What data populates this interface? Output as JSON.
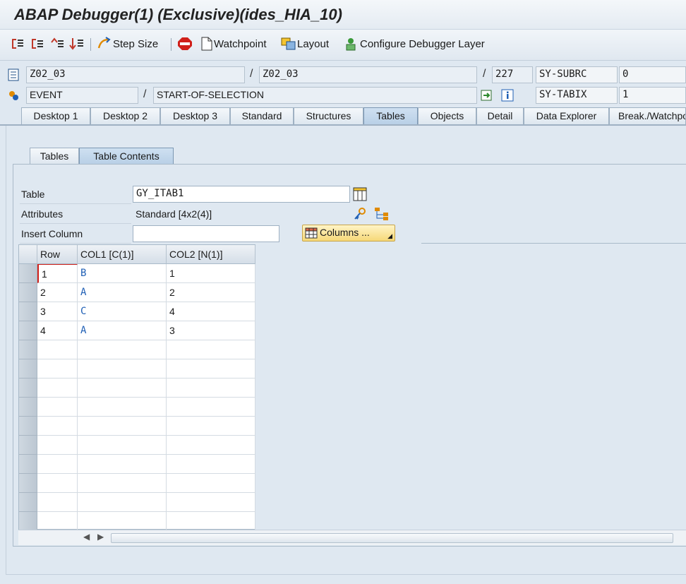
{
  "window": {
    "title": "ABAP Debugger(1)  (Exclusive)(ides_HIA_10)"
  },
  "toolbar": {
    "icons": [
      "step-into-icon",
      "step-over-icon",
      "return-icon",
      "continue-icon"
    ],
    "step_size_label": "Step Size",
    "watchpoint_label": "Watchpoint",
    "layout_label": "Layout",
    "configure_label": "Configure Debugger Layer"
  },
  "info": {
    "program": "Z02_03",
    "include": "Z02_03",
    "line": "227",
    "event_type": "EVENT",
    "event_name": "START-OF-SELECTION",
    "sy_subrc_label": "SY-SUBRC",
    "sy_subrc_value": "0",
    "sy_tabix_label": "SY-TABIX",
    "sy_tabix_value": "1",
    "slash": "/"
  },
  "tabs": [
    "Desktop 1",
    "Desktop 2",
    "Desktop 3",
    "Standard",
    "Structures",
    "Tables",
    "Objects",
    "Detail",
    "Data Explorer",
    "Break./Watchpoints"
  ],
  "active_tab": "Tables",
  "subtabs": [
    "Tables",
    "Table Contents"
  ],
  "active_subtab": "Table Contents",
  "form": {
    "table_label": "Table",
    "table_value": "GY_ITAB1",
    "attributes_label": "Attributes",
    "attributes_value": "Standard [4x2(4)]",
    "insert_column_label": "Insert Column",
    "insert_column_value": "",
    "columns_button": "Columns ..."
  },
  "grid": {
    "headers": [
      "Row",
      "COL1 [C(1)]",
      "COL2 [N(1)]"
    ],
    "rows": [
      [
        "1",
        "B",
        "1"
      ],
      [
        "2",
        "A",
        "2"
      ],
      [
        "3",
        "C",
        "4"
      ],
      [
        "4",
        "A",
        "3"
      ]
    ],
    "empty_rows": 10
  },
  "colors": {
    "accent": "#1f5fb5",
    "background": "#dfe8f1"
  }
}
